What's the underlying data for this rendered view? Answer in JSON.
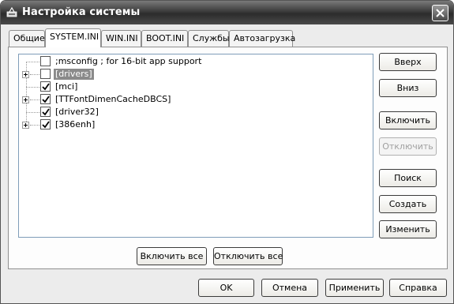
{
  "window": {
    "title": "Настройка системы"
  },
  "tabs": [
    {
      "label": "Общие"
    },
    {
      "label": "SYSTEM.INI"
    },
    {
      "label": "WIN.INI"
    },
    {
      "label": "BOOT.INI"
    },
    {
      "label": "Службы"
    },
    {
      "label": "Автозагрузка"
    }
  ],
  "active_tab": "SYSTEM.INI",
  "tree": {
    "items": [
      {
        "label": ";msconfig ; for 16-bit app support",
        "checked": false,
        "expandable": false,
        "selected": false
      },
      {
        "label": "[drivers]",
        "checked": false,
        "expandable": true,
        "selected": true
      },
      {
        "label": "[mci]",
        "checked": true,
        "expandable": false,
        "selected": false
      },
      {
        "label": "[TTFontDimenCacheDBCS]",
        "checked": true,
        "expandable": true,
        "selected": false
      },
      {
        "label": "[driver32]",
        "checked": true,
        "expandable": false,
        "selected": false
      },
      {
        "label": "[386enh]",
        "checked": true,
        "expandable": true,
        "selected": false
      }
    ]
  },
  "side_buttons": {
    "up": "Вверх",
    "down": "Вниз",
    "enable": "Включить",
    "disable": "Отключить",
    "find": "Поиск",
    "create": "Создать",
    "edit": "Изменить"
  },
  "bottom_panel_buttons": {
    "enable_all": "Включить все",
    "disable_all": "Отключить все"
  },
  "dialog_buttons": {
    "ok": "OK",
    "cancel": "Отмена",
    "apply": "Применить",
    "help": "Справка"
  }
}
